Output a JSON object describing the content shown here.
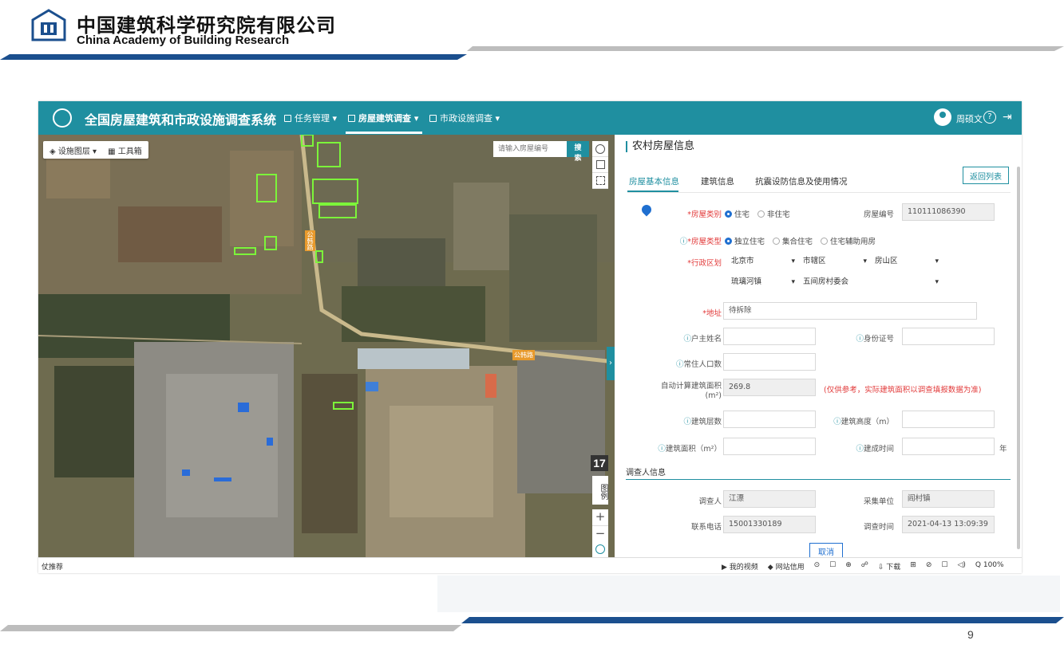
{
  "slide": {
    "org_name_cn": "中国建筑科学研究院有限公司",
    "org_name_en": "China Academy of Building Research",
    "page_number": "9",
    "colors": {
      "accent_blue": "#1b4f8e",
      "accent_gray": "#b5b5b5"
    }
  },
  "app": {
    "title": "全国房屋建筑和市政设施调查系统",
    "nav": [
      {
        "label": "任务管理 ▾",
        "icon": "clipboard-icon"
      },
      {
        "label": "房屋建筑调查 ▾",
        "icon": "house-icon",
        "active": true
      },
      {
        "label": "市政设施调查 ▾",
        "icon": "building-icon"
      }
    ],
    "user_name": "周硕文",
    "help_glyph": "?",
    "logout_glyph": "⇥",
    "colors": {
      "topbar": "#1f8fa0",
      "link": "#1f6fd0",
      "required": "#e23b3b"
    }
  },
  "map": {
    "layer_button": "设施图层 ▾",
    "toolbox_button": "工具箱",
    "search_placeholder": "请输入房屋编号",
    "search_button": "搜索",
    "road_label_1": "公韩路",
    "road_label_2": "公韩路",
    "zoom_level": "17",
    "legend_button": "图例",
    "zoom_in": "+",
    "zoom_out": "−"
  },
  "form": {
    "panel_title": "农村房屋信息",
    "tabs": [
      "房屋基本信息",
      "建筑信息",
      "抗震设防信息及使用情况"
    ],
    "back_button": "返回列表",
    "house_category": {
      "label": "*房屋类别",
      "options": [
        "住宅",
        "非住宅"
      ],
      "selected": "住宅"
    },
    "house_code": {
      "label": "房屋编号",
      "value": "110111086390"
    },
    "house_type": {
      "label": "*房屋类型",
      "options": [
        "独立住宅",
        "集合住宅",
        "住宅辅助用房"
      ],
      "selected": "独立住宅"
    },
    "region": {
      "label": "*行政区划",
      "province": "北京市",
      "city": "市辖区",
      "district": "房山区",
      "town": "琉璃河镇",
      "village": "五间房村委会"
    },
    "address": {
      "label": "*地址",
      "value": "待拆除"
    },
    "owner_name": {
      "label": "户主姓名",
      "value": ""
    },
    "id_number": {
      "label": "身份证号",
      "value": ""
    },
    "resident_pop": {
      "label": "常住人口数",
      "value": ""
    },
    "auto_area": {
      "label": "自动计算建筑面积",
      "unit": "(m²)",
      "value": "269.8",
      "hint": "(仅供参考，实际建筑面积以调查填报数据为准)"
    },
    "floors": {
      "label": "建筑层数",
      "value": ""
    },
    "height": {
      "label": "建筑高度（m）",
      "value": ""
    },
    "area": {
      "label": "建筑面积（m²）",
      "value": ""
    },
    "built_year": {
      "label": "建成时间",
      "value": "",
      "suffix": "年"
    },
    "surveyor_section": "调查人信息",
    "surveyor": {
      "label": "调查人",
      "value": "江漂"
    },
    "unit": {
      "label": "采集单位",
      "value": "阎村镇"
    },
    "phone": {
      "label": "联系电话",
      "value": "15001330189"
    },
    "survey_time": {
      "label": "调查时间",
      "value": "2021-04-13 13:09:39"
    },
    "cancel_button": "取消"
  },
  "browser_status": {
    "left": "仗推荐",
    "items": [
      "▶ 我的视频",
      "◆ 网站信用",
      "⊙",
      "☐",
      "⊕",
      "☍",
      "⇩ 下载",
      "⊞",
      "⊘",
      "☐",
      "◁)",
      "Q 100%"
    ]
  }
}
